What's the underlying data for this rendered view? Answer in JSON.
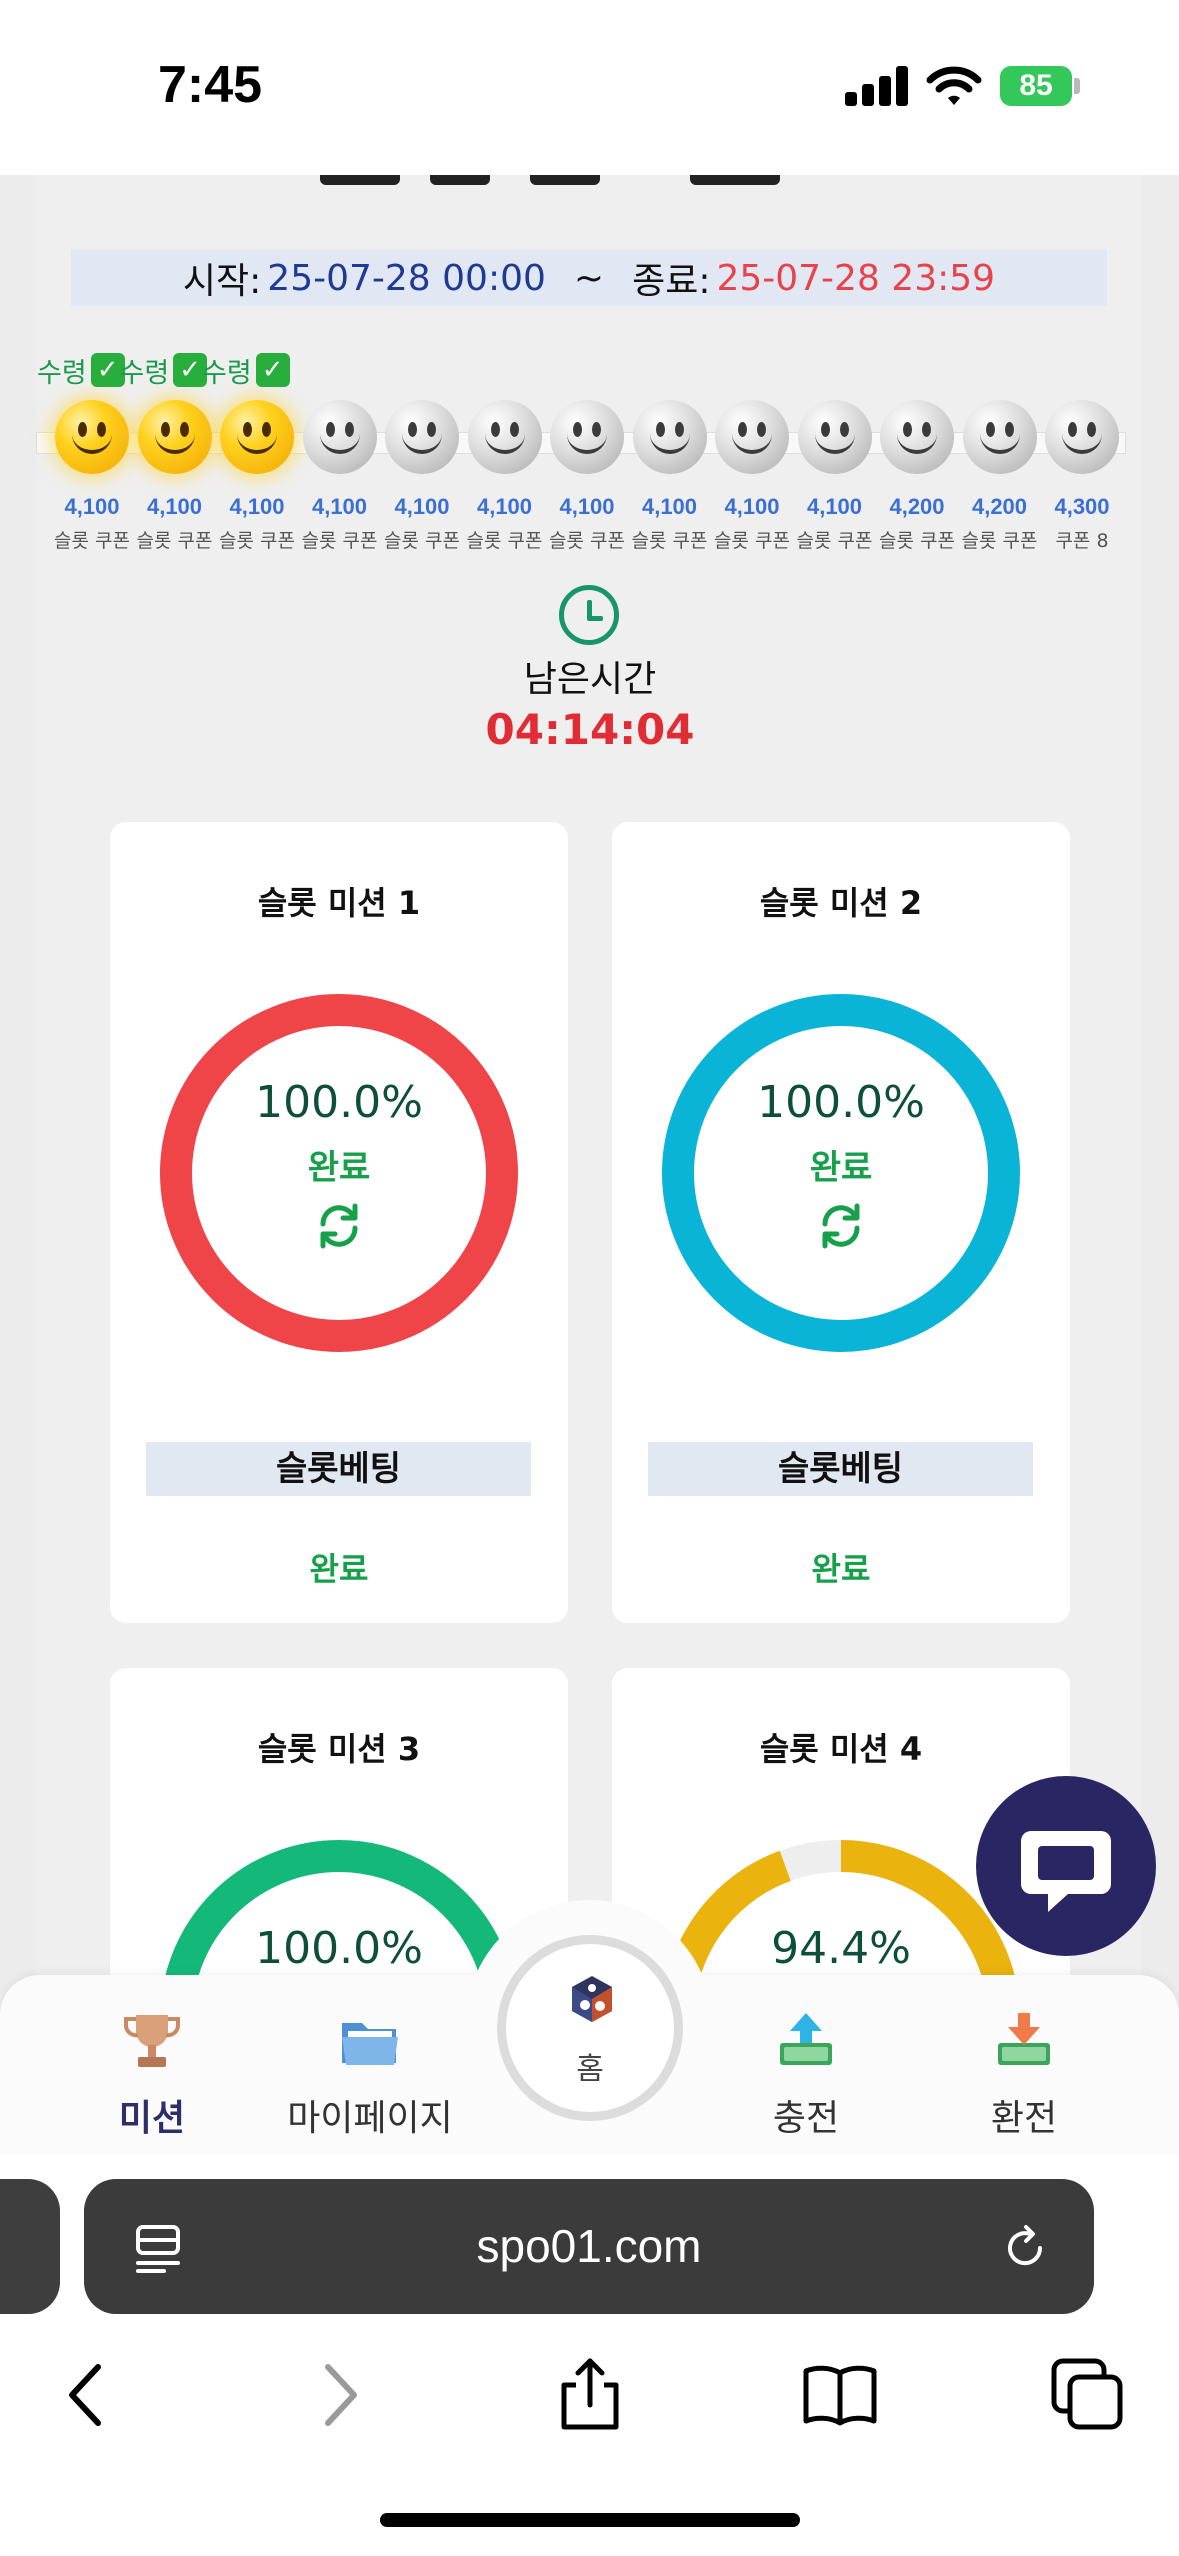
{
  "status_bar": {
    "time": "7:45",
    "battery": "85"
  },
  "event": {
    "start_label": "시작:",
    "start_value": "25-07-28 00:00",
    "separator": "~",
    "end_label": "종료:",
    "end_value": "25-07-28 23:59"
  },
  "coupons": {
    "claimed_label": "수령",
    "items": [
      {
        "amount": "4,100",
        "name": "슬롯 쿠폰",
        "claimed": true
      },
      {
        "amount": "4,100",
        "name": "슬롯 쿠폰",
        "claimed": true
      },
      {
        "amount": "4,100",
        "name": "슬롯 쿠폰",
        "claimed": true
      },
      {
        "amount": "4,100",
        "name": "슬롯 쿠폰",
        "claimed": false
      },
      {
        "amount": "4,100",
        "name": "슬롯 쿠폰",
        "claimed": false
      },
      {
        "amount": "4,100",
        "name": "슬롯 쿠폰",
        "claimed": false
      },
      {
        "amount": "4,100",
        "name": "슬롯 쿠폰",
        "claimed": false
      },
      {
        "amount": "4,100",
        "name": "슬롯 쿠폰",
        "claimed": false
      },
      {
        "amount": "4,100",
        "name": "슬롯 쿠폰",
        "claimed": false
      },
      {
        "amount": "4,100",
        "name": "슬롯 쿠폰",
        "claimed": false
      },
      {
        "amount": "4,200",
        "name": "슬롯 쿠폰",
        "claimed": false
      },
      {
        "amount": "4,200",
        "name": "슬롯 쿠폰",
        "claimed": false
      },
      {
        "amount": "4,300",
        "name": "쿠폰 8",
        "claimed": false
      }
    ]
  },
  "timer": {
    "label": "남은시간",
    "value": "04:14:04"
  },
  "missions": [
    {
      "title": "슬롯 미션 1",
      "percent": "100.0%",
      "progress": 1.0,
      "status": "완료",
      "color": "#ef4448",
      "type_label": "슬롯베팅",
      "done_label": "완료"
    },
    {
      "title": "슬롯 미션 2",
      "percent": "100.0%",
      "progress": 1.0,
      "status": "완료",
      "color": "#0ab4d6",
      "type_label": "슬롯베팅",
      "done_label": "완료"
    },
    {
      "title": "슬롯 미션 3",
      "percent": "100.0%",
      "progress": 1.0,
      "color": "#14b87a"
    },
    {
      "title": "슬롯 미션 4",
      "percent": "94.4%",
      "progress": 0.944,
      "color": "#eab30e"
    }
  ],
  "bottom_nav": {
    "mission": "미션",
    "mypage": "마이페이지",
    "home": "홈",
    "deposit": "충전",
    "withdraw": "환전"
  },
  "browser": {
    "url": "spo01.com"
  }
}
